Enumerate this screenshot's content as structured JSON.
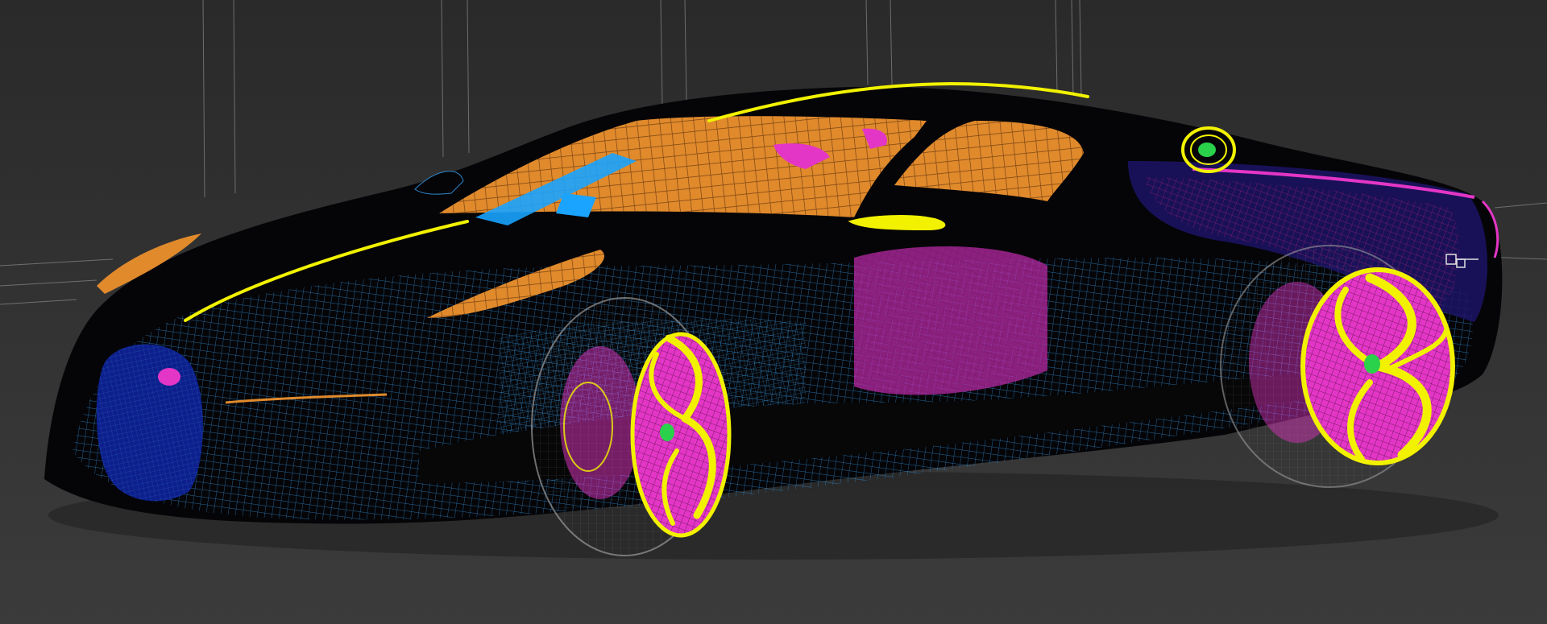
{
  "viewport": {
    "colors": {
      "background_top": "#2a2a2a",
      "background_bottom": "#3a3a3a",
      "body": "#050508",
      "mesh_blue": "#2f86c9",
      "accent_orange": "#e08a2c",
      "accent_magenta": "#e436c6",
      "accent_yellow": "#f2f200",
      "accent_cyan": "#1aa3ff",
      "accent_green": "#2ad14a",
      "grille_blue": "#0d1f8c",
      "guide_gray": "#8a8a8a"
    },
    "icons": {
      "badge": "badge-icon",
      "fuel_cap": "fuel-cap-icon"
    }
  }
}
